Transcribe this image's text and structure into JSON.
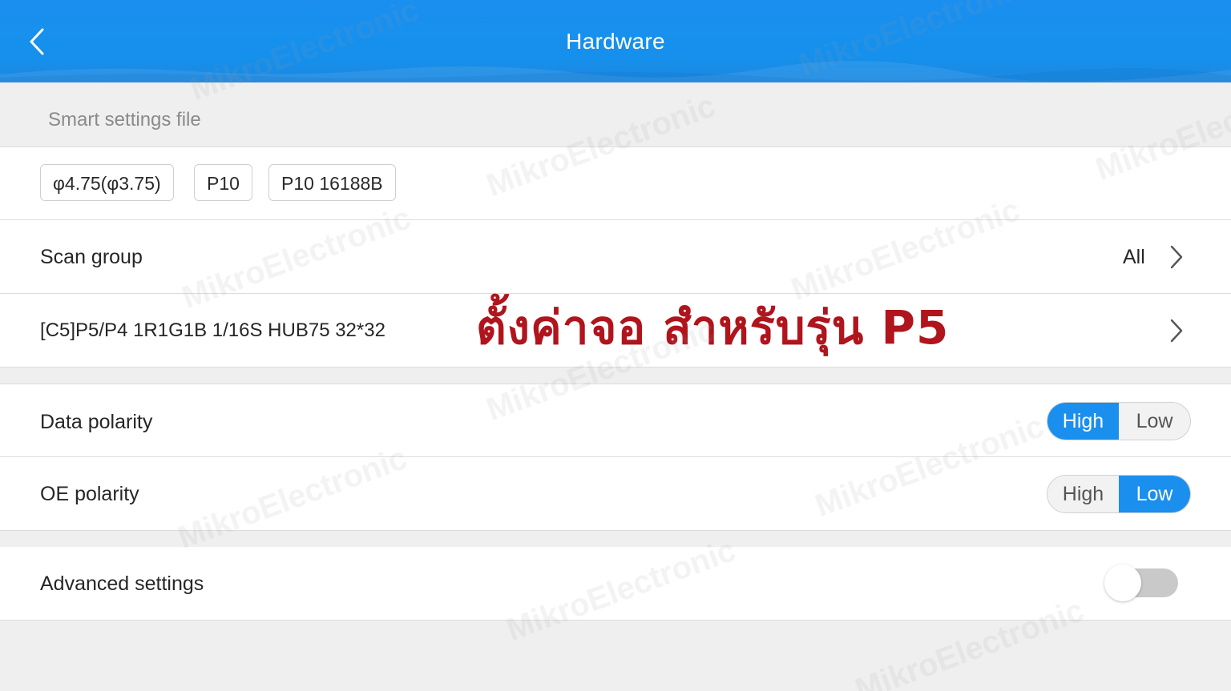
{
  "header": {
    "title": "Hardware",
    "back_icon": "chevron-left-icon",
    "color": "#1a8ff0"
  },
  "smart_settings": {
    "label": "Smart settings file",
    "chips": [
      "φ4.75(φ3.75)",
      "P10",
      "P10 16188B"
    ]
  },
  "scan_group": {
    "label": "Scan group",
    "value": "All"
  },
  "module": {
    "label": "[C5]P5/P4 1R1G1B 1/16S HUB75 32*32"
  },
  "overlay": {
    "text": "ตั้งค่าจอ สำหรับรุ่น P5",
    "color": "#b0141c"
  },
  "data_polarity": {
    "label": "Data polarity",
    "options": [
      "High",
      "Low"
    ],
    "selected": "High"
  },
  "oe_polarity": {
    "label": "OE polarity",
    "options": [
      "High",
      "Low"
    ],
    "selected": "Low"
  },
  "advanced": {
    "label": "Advanced settings",
    "enabled": false
  },
  "accent_color": "#1a8fee",
  "watermark_text": "MikroElectronic"
}
